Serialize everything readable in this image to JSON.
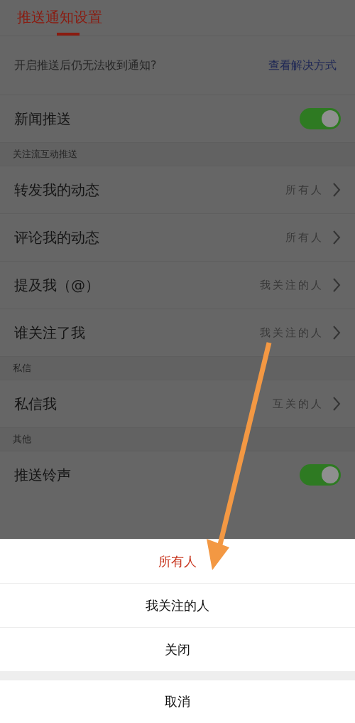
{
  "header": {
    "title": "推送通知设置"
  },
  "help": {
    "text": "开启推送后仍无法收到通知?",
    "link": "查看解决方式"
  },
  "sections": [
    {
      "items": [
        {
          "kind": "toggle",
          "label": "新闻推送",
          "on": true
        }
      ]
    },
    {
      "header": "关注流互动推送",
      "items": [
        {
          "kind": "choice",
          "label": "转发我的动态",
          "value": "所有人"
        },
        {
          "kind": "choice",
          "label": "评论我的动态",
          "value": "所有人"
        },
        {
          "kind": "choice",
          "label": "提及我（@）",
          "value": "我关注的人"
        },
        {
          "kind": "choice",
          "label": "谁关注了我",
          "value": "我关注的人"
        }
      ]
    },
    {
      "header": "私信",
      "items": [
        {
          "kind": "choice",
          "label": "私信我",
          "value": "互关的人"
        }
      ]
    },
    {
      "header": "其他",
      "items": [
        {
          "kind": "toggle",
          "label": "推送铃声",
          "on": true
        }
      ]
    }
  ],
  "action_sheet": {
    "options": [
      {
        "label": "所有人",
        "selected": true
      },
      {
        "label": "我关注的人",
        "selected": false
      },
      {
        "label": "关闭",
        "selected": false
      }
    ],
    "cancel": "取消"
  }
}
